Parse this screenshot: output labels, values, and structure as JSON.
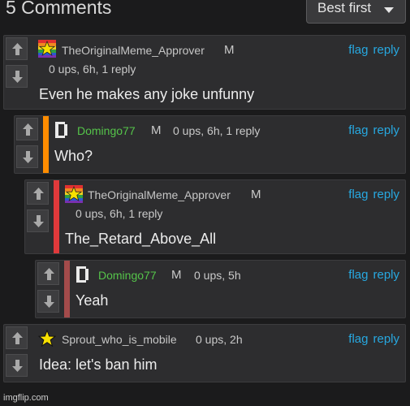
{
  "header": {
    "title": "5 Comments",
    "sort_label": "Best first"
  },
  "colors": {
    "link": "#27a8e0",
    "op_bar": "#ff8c00",
    "red_bar": "#e0393b",
    "faded_bar": "#a44b4b",
    "domingo_name": "#55c44a"
  },
  "comments": [
    {
      "username": "TheOriginalMeme_Approver",
      "badge": "M",
      "meta": "0 ups, 6h, 1 reply",
      "text": "Even he makes any joke unfunny",
      "flag": "flag",
      "reply": "reply",
      "avatar": "rainbow-star-icon"
    },
    {
      "username": "Domingo77",
      "badge": "M",
      "meta": "0 ups, 6h, 1 reply",
      "text": "Who?",
      "flag": "flag",
      "reply": "reply",
      "avatar": "pixel-d-icon"
    },
    {
      "username": "TheOriginalMeme_Approver",
      "badge": "M",
      "meta": "0 ups, 6h, 1 reply",
      "text": "The_Retard_Above_All",
      "flag": "flag",
      "reply": "reply",
      "avatar": "rainbow-star-icon"
    },
    {
      "username": "Domingo77",
      "badge": "M",
      "meta": "0 ups, 5h",
      "text": "Yeah",
      "flag": "flag",
      "reply": "reply",
      "avatar": "pixel-d-icon"
    },
    {
      "username": "Sprout_who_is_mobile",
      "badge": "",
      "meta": "0 ups, 2h",
      "text": "Idea: let's ban him",
      "flag": "flag",
      "reply": "reply",
      "avatar": "star-icon"
    }
  ],
  "footer": {
    "watermark": "imgflip.com"
  }
}
